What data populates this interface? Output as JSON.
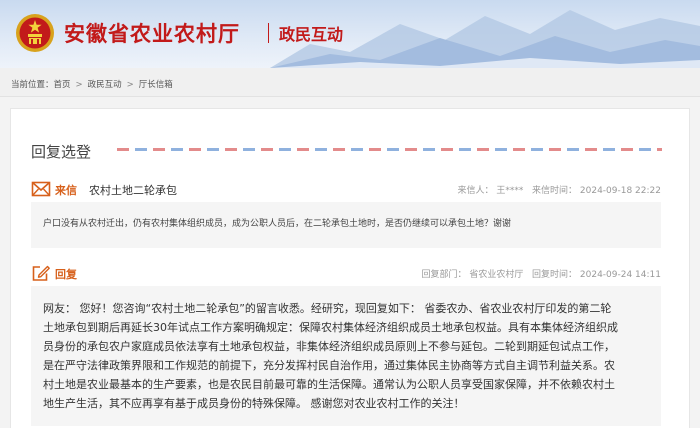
{
  "header": {
    "site_title": "安徽省农业农村厅",
    "section_title": "政民互动"
  },
  "breadcrumb": {
    "prefix": "当前位置：",
    "items": [
      "首页",
      "政民互动",
      "厅长信箱"
    ]
  },
  "panel": {
    "title": "回复选登"
  },
  "letter": {
    "label": "来信",
    "subject": "农村土地二轮承包",
    "sender_label": "来信人：",
    "sender": "王****",
    "time_label": "来信时间：",
    "time": "2024-09-18 22:22",
    "content": "户口没有从农村迁出，仍有农村集体组织成员，成为公职人员后，在二轮承包土地时，是否仍继续可以承包土地？谢谢"
  },
  "reply": {
    "label": "回复",
    "dept_label": "回复部门：",
    "dept": "省农业农村厅",
    "time_label": "回复时间：",
    "time": "2024-09-24 14:11",
    "lines": [
      "网友：  您好！您咨询“农村土地二轮承包”的留言收悉。经研究，现回复如下：  省委农办、省农业农村厅印发的第二轮",
      "土地承包到期后再延长30年试点工作方案明确规定：保障农村集体经济组织成员土地承包权益。具有本集体经济组织成",
      "员身份的承包农户家庭成员依法享有土地承包权益，非集体经济组织成员原则上不参与延包。二轮到期延包试点工作，",
      "是在严守法律政策界限和工作规范的前提下，充分发挥村民自治作用，通过集体民主协商等方式自主调节利益关系。农",
      "村土地是农业最基本的生产要素，也是农民目前最可靠的生活保障。通常认为公职人员享受国家保障，并不依赖农村土",
      "地生产生活，其不应再享有基于成员身份的特殊保障。 感谢您对农业农村工作的关注！"
    ]
  },
  "colors": {
    "brand_red": "#c21a1a",
    "accent_orange": "#d7601b"
  },
  "icons": {
    "emblem": "national-emblem-icon",
    "letter": "envelope-icon",
    "reply": "reply-edit-icon"
  }
}
